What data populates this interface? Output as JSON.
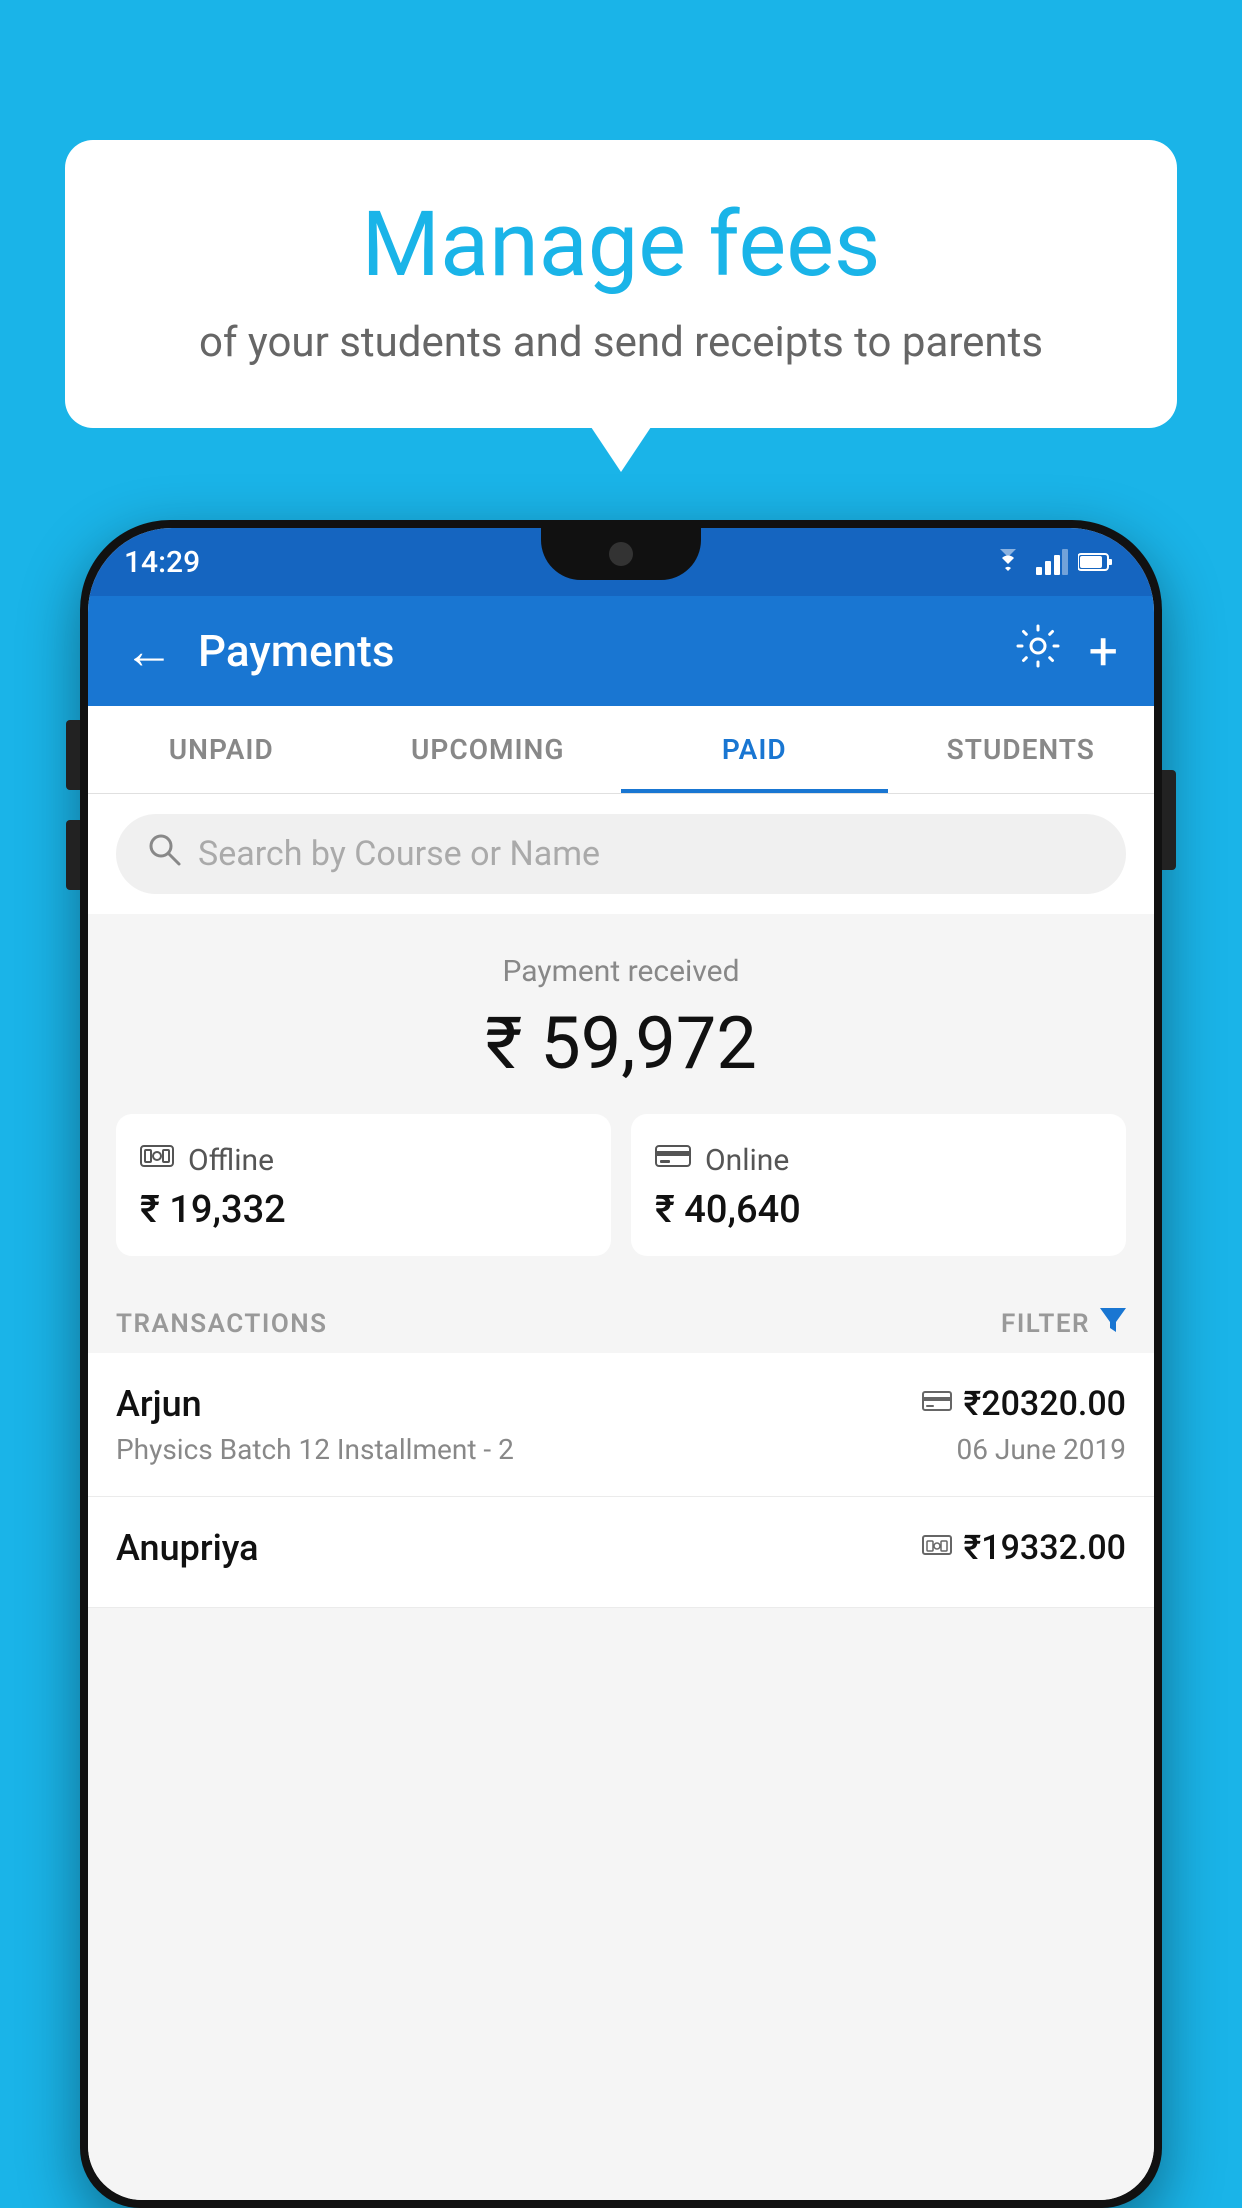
{
  "page": {
    "background_color": "#1ab4e8"
  },
  "bubble": {
    "title": "Manage fees",
    "subtitle": "of your students and send receipts to parents"
  },
  "status_bar": {
    "time": "14:29",
    "icons": [
      "wifi",
      "signal",
      "battery"
    ]
  },
  "app_bar": {
    "title": "Payments",
    "back_label": "←",
    "gear_label": "⚙",
    "plus_label": "+"
  },
  "tabs": [
    {
      "label": "UNPAID",
      "active": false
    },
    {
      "label": "UPCOMING",
      "active": false
    },
    {
      "label": "PAID",
      "active": true
    },
    {
      "label": "STUDENTS",
      "active": false
    }
  ],
  "search": {
    "placeholder": "Search by Course or Name"
  },
  "payment_summary": {
    "label": "Payment received",
    "amount": "₹ 59,972",
    "offline": {
      "label": "Offline",
      "amount": "₹ 19,332"
    },
    "online": {
      "label": "Online",
      "amount": "₹ 40,640"
    }
  },
  "transactions": {
    "header": "TRANSACTIONS",
    "filter": "FILTER",
    "items": [
      {
        "name": "Arjun",
        "amount": "₹20320.00",
        "detail": "Physics Batch 12 Installment - 2",
        "date": "06 June 2019",
        "payment_type": "card"
      },
      {
        "name": "Anupriya",
        "amount": "₹19332.00",
        "detail": "",
        "date": "",
        "payment_type": "cash"
      }
    ]
  }
}
